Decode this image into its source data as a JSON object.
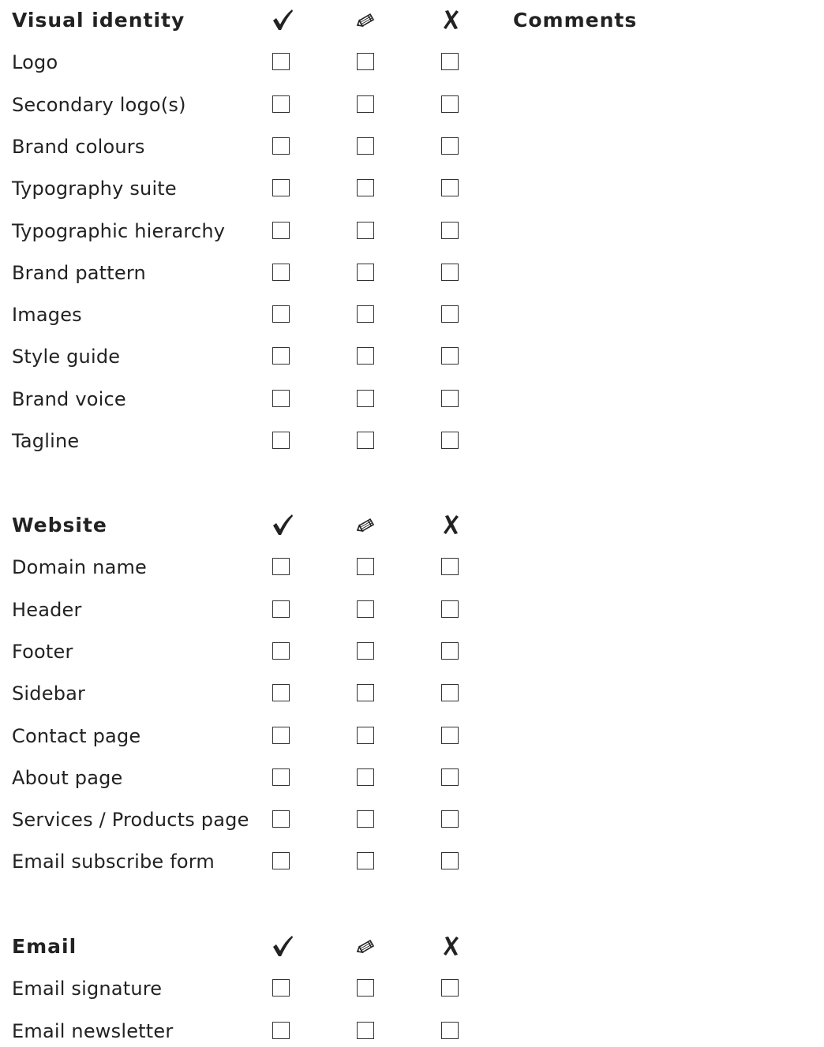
{
  "comments_label": "Comments",
  "icons": {
    "col_done": "checkmark-icon",
    "col_edit": "pencil-icon",
    "col_no": "cross-icon"
  },
  "colors": {
    "text": "#222222",
    "border": "#333333"
  },
  "sections": [
    {
      "title": "Visual identity",
      "items": [
        "Logo",
        "Secondary logo(s)",
        "Brand colours",
        "Typography suite",
        "Typographic hierarchy",
        "Brand pattern",
        "Images",
        "Style guide",
        "Brand voice",
        "Tagline"
      ]
    },
    {
      "title": "Website",
      "items": [
        "Domain name",
        "Header",
        "Footer",
        "Sidebar",
        "Contact page",
        "About page",
        "Services / Products page",
        "Email subscribe form"
      ]
    },
    {
      "title": "Email",
      "items": [
        "Email signature",
        "Email newsletter"
      ]
    }
  ]
}
